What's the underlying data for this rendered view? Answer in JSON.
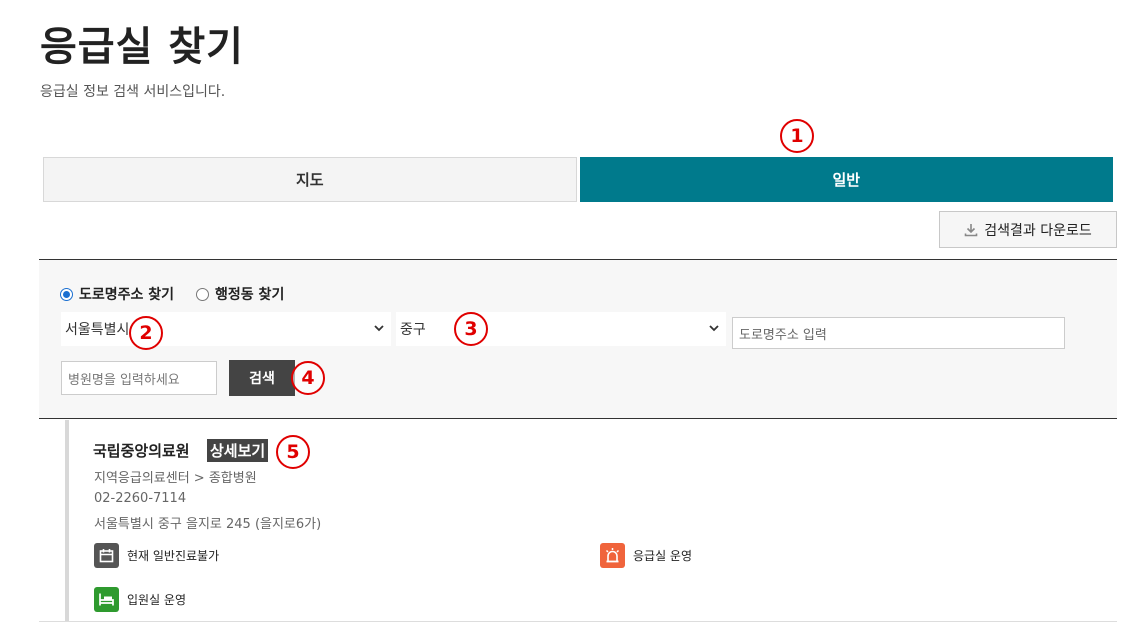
{
  "header": {
    "title": "응급실 찾기",
    "subtitle": "응급실 정보 검색 서비스입니다."
  },
  "tabs": [
    {
      "label": "지도",
      "active": false
    },
    {
      "label": "일반",
      "active": true
    }
  ],
  "download": {
    "label": "검색결과 다운로드",
    "icon": "download-icon"
  },
  "search": {
    "radios": [
      {
        "label": "도로명주소 찾기",
        "checked": true
      },
      {
        "label": "행정동 찾기",
        "checked": false
      }
    ],
    "city_select": "서울특별시",
    "district_select": "중구",
    "road_placeholder": "도로명주소 입력",
    "hospital_placeholder": "병원명을 입력하세요",
    "search_label": "검색"
  },
  "result": {
    "name": "국립중앙의료원",
    "detail_label": "상세보기",
    "type": "지역응급의료센터 > 종합병원",
    "phone": "02-2260-7114",
    "address": "서울특별시 중구 을지로 245 (을지로6가)",
    "statuses": [
      {
        "label": "현재 일반진료불가",
        "icon": "calendar-icon",
        "color": "#555555"
      },
      {
        "label": "응급실 운영",
        "icon": "siren-icon",
        "color": "#f0643c"
      },
      {
        "label": "입원실 운영",
        "icon": "bed-icon",
        "color": "#2e9a2e"
      }
    ]
  },
  "annotations": [
    "1",
    "2",
    "3",
    "4",
    "5"
  ],
  "colors": {
    "accent": "#007a8c",
    "dark_button": "#444444",
    "marker": "#e00000"
  }
}
